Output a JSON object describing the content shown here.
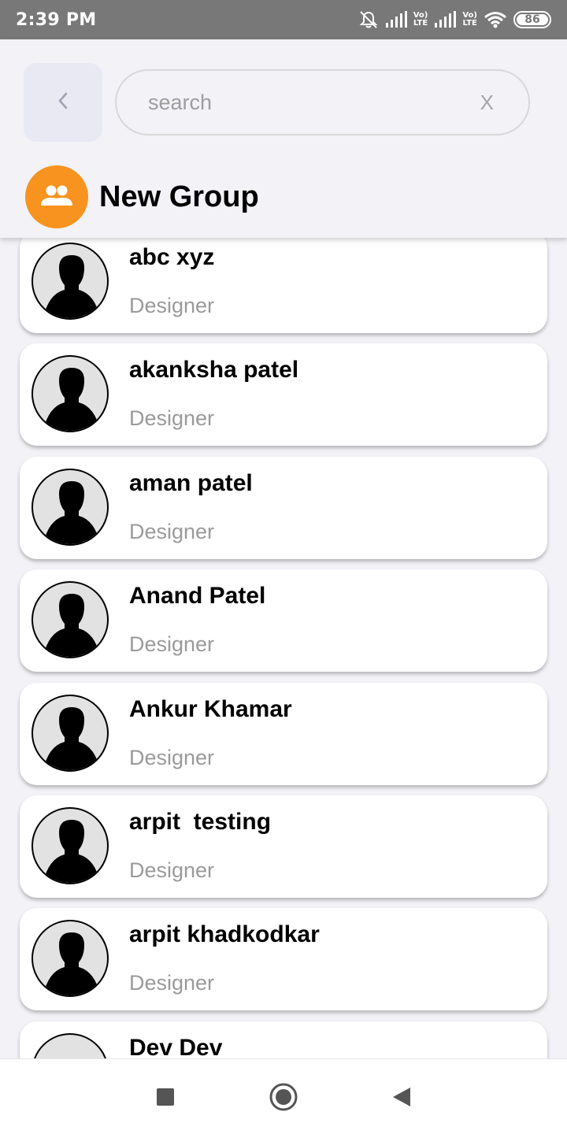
{
  "status_bar": {
    "time": "2:39 PM",
    "lte1_top": "Vo)",
    "lte1_bottom": "LTE",
    "lte2_top": "Vo)",
    "lte2_bottom": "LTE",
    "battery": "86",
    "icons": [
      "mute-icon",
      "signal-icon",
      "signal-icon",
      "wifi-icon",
      "battery-icon"
    ]
  },
  "header": {
    "back_icon": "chevron-left-icon",
    "search": {
      "placeholder": "search",
      "value": "",
      "clear_label": "X"
    },
    "new_group": {
      "icon": "group-icon",
      "label": "New Group",
      "color": "#f7931e"
    }
  },
  "contacts": [
    {
      "name": "abc xyz",
      "role": "Designer"
    },
    {
      "name": "akanksha patel",
      "role": "Designer"
    },
    {
      "name": "aman patel",
      "role": "Designer"
    },
    {
      "name": "Anand Patel",
      "role": "Designer"
    },
    {
      "name": "Ankur Khamar",
      "role": "Designer"
    },
    {
      "name": "arpit  testing",
      "role": "Designer"
    },
    {
      "name": "arpit khadkodkar",
      "role": "Designer"
    },
    {
      "name": "Dev Dev",
      "role": ""
    }
  ],
  "nav_bar": {
    "icons": [
      "recents-square-icon",
      "home-circle-icon",
      "back-triangle-icon"
    ]
  }
}
